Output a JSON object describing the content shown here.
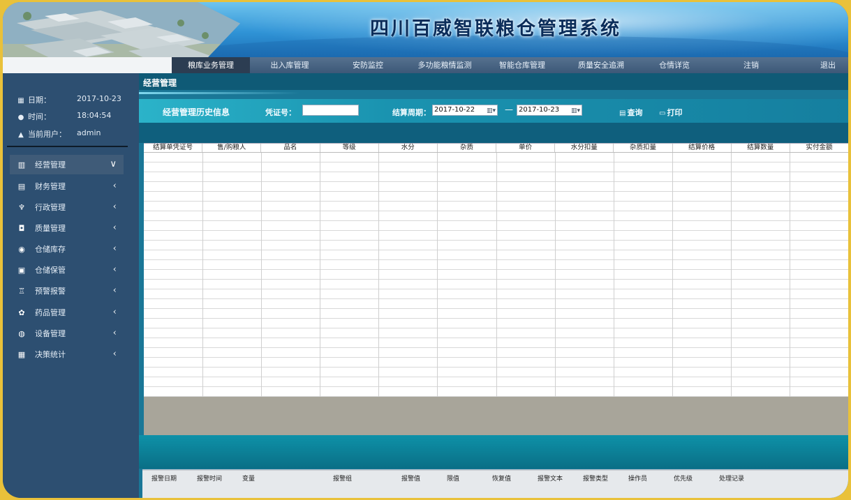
{
  "header": {
    "title": "四川百威智联粮仓管理系统"
  },
  "nav": {
    "items": [
      "粮库业务管理",
      "出入库管理",
      "安防监控",
      "多功能粮情监测",
      "智能仓库管理",
      "质量安全追溯",
      "仓情详览",
      "注销",
      "退出"
    ]
  },
  "sidebar": {
    "date_label": "日期：",
    "date_value": "2017-10-23",
    "time_label": "时间：",
    "time_value": "18:04:54",
    "user_label": "当前用户：",
    "user_value": "admin",
    "menu": [
      {
        "label": "经营管理",
        "icon": "business-icon"
      },
      {
        "label": "财务管理",
        "icon": "finance-icon"
      },
      {
        "label": "行政管理",
        "icon": "admin-icon"
      },
      {
        "label": "质量管理",
        "icon": "quality-icon"
      },
      {
        "label": "仓储库存",
        "icon": "inventory-icon"
      },
      {
        "label": "仓储保管",
        "icon": "storage-icon"
      },
      {
        "label": "预警报警",
        "icon": "alarm-icon"
      },
      {
        "label": "药品管理",
        "icon": "medicine-icon"
      },
      {
        "label": "设备管理",
        "icon": "device-icon"
      },
      {
        "label": "决策统计",
        "icon": "statistics-icon"
      }
    ]
  },
  "panel": {
    "title": "经营管理",
    "history_title": "经营管理历史信息",
    "voucher_label": "凭证号：",
    "voucher_value": "",
    "period_label": "结算周期：",
    "date_from": "2017-10-22",
    "date_to": "2017-10-23",
    "date_separator": "—",
    "query_label": "查询",
    "print_label": "打印"
  },
  "table": {
    "columns": [
      "结算单凭证号",
      "售/购粮人",
      "品名",
      "等级",
      "水分",
      "杂质",
      "单价",
      "水分扣量",
      "杂质扣量",
      "结算价格",
      "结算数量",
      "实付金额"
    ]
  },
  "alarm_table": {
    "columns": [
      "报警日期",
      "报警时间",
      "变量",
      "报警组",
      "报警值",
      "限值",
      "恢复值",
      "报警文本",
      "报警类型",
      "操作员",
      "优先级",
      "处理记录"
    ]
  },
  "colors": {
    "frame_border": "#e9c13a",
    "sidebar_bg": "#2d4f71",
    "main_bg": "#1a7797",
    "toolbar": "#2bb3c9"
  }
}
